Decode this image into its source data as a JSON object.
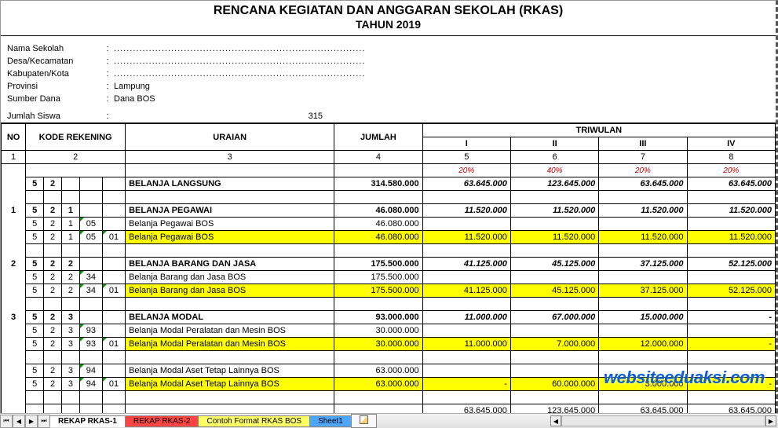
{
  "title_main": "RENCANA KEGIATAN DAN ANGGARAN SEKOLAH (RKAS)",
  "title_sub": "TAHUN 2019",
  "info": {
    "nama_sekolah_label": "Nama Sekolah",
    "nama_sekolah_val": "...............................................................................",
    "desa_label": "Desa/Kecamatan",
    "desa_val": "...............................................................................",
    "kab_label": "Kabupaten/Kota",
    "kab_val": "...............................................................................",
    "prov_label": "Provinsi",
    "prov_val": "Lampung",
    "sumber_label": "Sumber Dana",
    "sumber_val": "Dana BOS",
    "siswa_label": "Jumlah Siswa",
    "siswa_val": "315",
    "colon": ":"
  },
  "headers": {
    "no": "NO",
    "kode": "KODE REKENING",
    "uraian": "URAIAN",
    "jumlah": "JUMLAH",
    "triwulan": "TRIWULAN",
    "tw1": "I",
    "tw2": "II",
    "tw3": "III",
    "tw4": "IV",
    "c1": "1",
    "c2": "2",
    "c3": "3",
    "c4": "4",
    "c5": "5",
    "c6": "6",
    "c7": "7",
    "c8": "8"
  },
  "pct": {
    "p1": "20%",
    "p2": "40%",
    "p3": "20%",
    "p4": "20%"
  },
  "rows": {
    "bl": {
      "k1": "5",
      "k2": "2",
      "uraian": "BELANJA LANGSUNG",
      "jumlah": "314.580.000",
      "t1": "63.645.000",
      "t2": "123.645.000",
      "t3": "63.645.000",
      "t4": "63.645.000"
    },
    "r1h": {
      "no": "1",
      "k1": "5",
      "k2": "2",
      "k3": "1",
      "uraian": "BELANJA PEGAWAI",
      "jumlah": "46.080.000",
      "t1": "11.520.000",
      "t2": "11.520.000",
      "t3": "11.520.000",
      "t4": "11.520.000"
    },
    "r1a": {
      "k1": "5",
      "k2": "2",
      "k3": "1",
      "k4": "05",
      "uraian": "Belanja Pegawai BOS",
      "jumlah": "46.080.000"
    },
    "r1b": {
      "k1": "5",
      "k2": "2",
      "k3": "1",
      "k4": "05",
      "k5": "01",
      "uraian": "Belanja Pegawai BOS",
      "jumlah": "46.080.000",
      "t1": "11.520.000",
      "t2": "11.520.000",
      "t3": "11.520.000",
      "t4": "11.520.000"
    },
    "r2h": {
      "no": "2",
      "k1": "5",
      "k2": "2",
      "k3": "2",
      "uraian": "BELANJA BARANG DAN JASA",
      "jumlah": "175.500.000",
      "t1": "41.125.000",
      "t2": "45.125.000",
      "t3": "37.125.000",
      "t4": "52.125.000"
    },
    "r2a": {
      "k1": "5",
      "k2": "2",
      "k3": "2",
      "k4": "34",
      "uraian": "Belanja Barang dan Jasa BOS",
      "jumlah": "175.500.000"
    },
    "r2b": {
      "k1": "5",
      "k2": "2",
      "k3": "2",
      "k4": "34",
      "k5": "01",
      "uraian": "Belanja Barang dan Jasa BOS",
      "jumlah": "175.500.000",
      "t1": "41.125.000",
      "t2": "45.125.000",
      "t3": "37.125.000",
      "t4": "52.125.000"
    },
    "r3h": {
      "no": "3",
      "k1": "5",
      "k2": "2",
      "k3": "3",
      "uraian": "BELANJA MODAL",
      "jumlah": "93.000.000",
      "t1": "11.000.000",
      "t2": "67.000.000",
      "t3": "15.000.000",
      "t4": "-"
    },
    "r3a": {
      "k1": "5",
      "k2": "2",
      "k3": "3",
      "k4": "93",
      "uraian": "Belanja Modal Peralatan dan Mesin BOS",
      "jumlah": "30.000.000"
    },
    "r3b": {
      "k1": "5",
      "k2": "2",
      "k3": "3",
      "k4": "93",
      "k5": "01",
      "uraian": "Belanja Modal Peralatan dan Mesin BOS",
      "jumlah": "30.000.000",
      "t1": "11.000.000",
      "t2": "7.000.000",
      "t3": "12.000.000",
      "t4": "-"
    },
    "r3c": {
      "k1": "5",
      "k2": "2",
      "k3": "3",
      "k4": "94",
      "uraian": "Belanja Modal Aset Tetap Lainnya BOS",
      "jumlah": "63.000.000"
    },
    "r3d": {
      "k1": "5",
      "k2": "2",
      "k3": "3",
      "k4": "94",
      "k5": "01",
      "uraian": "Belanja Modal Aset Tetap Lainnya BOS",
      "jumlah": "63.000.000",
      "t1": "-",
      "t2": "60.000.000",
      "t3": "3.000.000",
      "t4": "-"
    },
    "tot": {
      "t1": "63.645.000",
      "t2": "123.645.000",
      "t3": "63.645.000",
      "t4": "63.645.000"
    }
  },
  "watermark": "websiteeduaksi.com",
  "tabs": {
    "nav_first": "⏮",
    "nav_prev": "◀",
    "nav_next": "▶",
    "nav_last": "⏭",
    "t1": "REKAP RKAS-1",
    "t2": "REKAP RKAS-2",
    "t3": "Contoh Format RKAS BOS",
    "t4": "Sheet1",
    "scroll_left": "◀",
    "scroll_right": "▶"
  },
  "chart_data": {
    "type": "table",
    "title": "RENCANA KEGIATAN DAN ANGGARAN SEKOLAH (RKAS) TAHUN 2019",
    "columns": [
      "NO",
      "KODE REKENING",
      "URAIAN",
      "JUMLAH",
      "TRIWULAN I",
      "TRIWULAN II",
      "TRIWULAN III",
      "TRIWULAN IV"
    ],
    "triwulan_pct": [
      20,
      40,
      20,
      20
    ],
    "rows": [
      {
        "kode": "5.2",
        "uraian": "BELANJA LANGSUNG",
        "jumlah": 314580000,
        "tw": [
          63645000,
          123645000,
          63645000,
          63645000
        ]
      },
      {
        "no": 1,
        "kode": "5.2.1",
        "uraian": "BELANJA PEGAWAI",
        "jumlah": 46080000,
        "tw": [
          11520000,
          11520000,
          11520000,
          11520000
        ]
      },
      {
        "kode": "5.2.1.05",
        "uraian": "Belanja Pegawai BOS",
        "jumlah": 46080000
      },
      {
        "kode": "5.2.1.05.01",
        "uraian": "Belanja Pegawai BOS",
        "jumlah": 46080000,
        "tw": [
          11520000,
          11520000,
          11520000,
          11520000
        ]
      },
      {
        "no": 2,
        "kode": "5.2.2",
        "uraian": "BELANJA BARANG DAN JASA",
        "jumlah": 175500000,
        "tw": [
          41125000,
          45125000,
          37125000,
          52125000
        ]
      },
      {
        "kode": "5.2.2.34",
        "uraian": "Belanja Barang dan Jasa BOS",
        "jumlah": 175500000
      },
      {
        "kode": "5.2.2.34.01",
        "uraian": "Belanja Barang dan Jasa BOS",
        "jumlah": 175500000,
        "tw": [
          41125000,
          45125000,
          37125000,
          52125000
        ]
      },
      {
        "no": 3,
        "kode": "5.2.3",
        "uraian": "BELANJA MODAL",
        "jumlah": 93000000,
        "tw": [
          11000000,
          67000000,
          15000000,
          null
        ]
      },
      {
        "kode": "5.2.3.93",
        "uraian": "Belanja Modal Peralatan dan Mesin BOS",
        "jumlah": 30000000
      },
      {
        "kode": "5.2.3.93.01",
        "uraian": "Belanja Modal Peralatan dan Mesin BOS",
        "jumlah": 30000000,
        "tw": [
          11000000,
          7000000,
          12000000,
          null
        ]
      },
      {
        "kode": "5.2.3.94",
        "uraian": "Belanja Modal Aset Tetap Lainnya BOS",
        "jumlah": 63000000
      },
      {
        "kode": "5.2.3.94.01",
        "uraian": "Belanja Modal Aset Tetap Lainnya BOS",
        "jumlah": 63000000,
        "tw": [
          null,
          60000000,
          3000000,
          null
        ]
      }
    ],
    "totals_tw": [
      63645000,
      123645000,
      63645000,
      63645000
    ]
  }
}
